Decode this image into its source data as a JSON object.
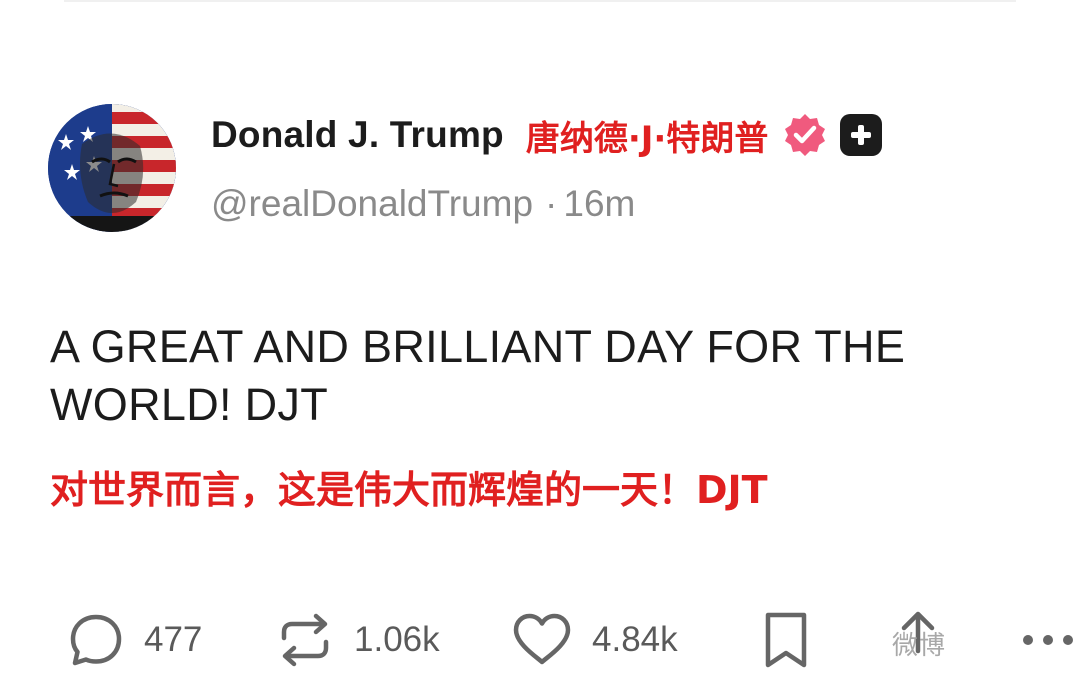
{
  "author": {
    "display_name": "Donald J. Trump",
    "display_name_translation": "唐纳德·J·特朗普",
    "handle": "@realDonaldTrump",
    "separator": "·",
    "time_ago": "16m",
    "verified_color": "#f05a7e"
  },
  "post": {
    "text": "A GREAT AND BRILLIANT DAY FOR THE WORLD! DJT",
    "translation": "对世界而言，这是伟大而辉煌的一天！DJT",
    "translation_color": "#e02020"
  },
  "actions": {
    "replies": {
      "icon": "reply-icon",
      "count": "477"
    },
    "reposts": {
      "icon": "repost-icon",
      "count": "1.06k"
    },
    "likes": {
      "icon": "heart-icon",
      "count": "4.84k"
    },
    "bookmark": {
      "icon": "bookmark-icon"
    },
    "share": {
      "icon": "share-icon"
    },
    "more": {
      "icon": "more-icon"
    }
  },
  "watermark": "微博"
}
